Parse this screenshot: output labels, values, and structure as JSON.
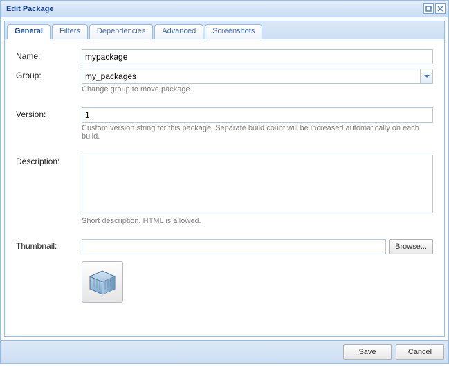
{
  "window": {
    "title": "Edit Package"
  },
  "tabs": {
    "general": "General",
    "filters": "Filters",
    "dependencies": "Dependencies",
    "advanced": "Advanced",
    "screenshots": "Screenshots"
  },
  "form": {
    "name_label": "Name:",
    "name_value": "mypackage",
    "group_label": "Group:",
    "group_value": "my_packages",
    "group_hint": "Change group to move package.",
    "version_label": "Version:",
    "version_value": "1",
    "version_hint": "Custom version string for this package. Separate build count will be increased automatically on each build.",
    "description_label": "Description:",
    "description_value": "",
    "description_hint": "Short description. HTML is allowed.",
    "thumbnail_label": "Thumbnail:",
    "thumbnail_value": "",
    "browse_label": "Browse..."
  },
  "buttons": {
    "save": "Save",
    "cancel": "Cancel"
  }
}
